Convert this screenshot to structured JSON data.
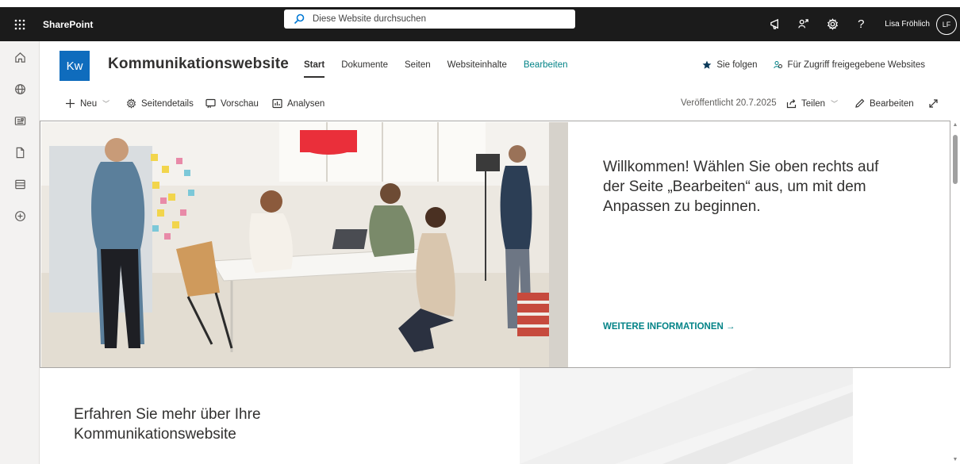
{
  "suitebar": {
    "app_name": "SharePoint",
    "search_placeholder": "Diese Website durchsuchen",
    "user_name": "Lisa Fröhlich",
    "user_initials": "LF",
    "icons": [
      "waffle-icon",
      "megaphone-icon",
      "share-people-icon",
      "gear-icon",
      "help-icon"
    ],
    "help_glyph": "?"
  },
  "rail": {
    "items": [
      "home-icon",
      "globe-icon",
      "news-icon",
      "document-icon",
      "list-icon",
      "add-circle-icon"
    ]
  },
  "site": {
    "logo_initials": "Kw",
    "logo_color": "#0f6cbd",
    "title": "Kommunikationswebsite",
    "nav": [
      {
        "label": "Start",
        "active": true
      },
      {
        "label": "Dokumente"
      },
      {
        "label": "Seiten"
      },
      {
        "label": "Websiteinhalte"
      },
      {
        "label": "Bearbeiten",
        "accent": true
      }
    ],
    "follow_label": "Sie folgen",
    "shared_label": "Für Zugriff freigegebene Websites"
  },
  "command_bar": {
    "new_label": "Neu",
    "page_details_label": "Seitendetails",
    "preview_label": "Vorschau",
    "analytics_label": "Analysen",
    "published_label": "Veröffentlicht 20.7.2025",
    "share_label": "Teilen",
    "edit_label": "Bearbeiten"
  },
  "hero": {
    "heading": "Willkommen! Wählen Sie oben rechts auf der Seite „Bearbeiten“ aus, um mit dem Anpassen zu beginnen.",
    "link_label": "WEITERE INFORMATIONEN →",
    "accent_color": "#038387"
  },
  "section": {
    "title": "Erfahren Sie mehr über Ihre Kommunikationswebsite"
  }
}
